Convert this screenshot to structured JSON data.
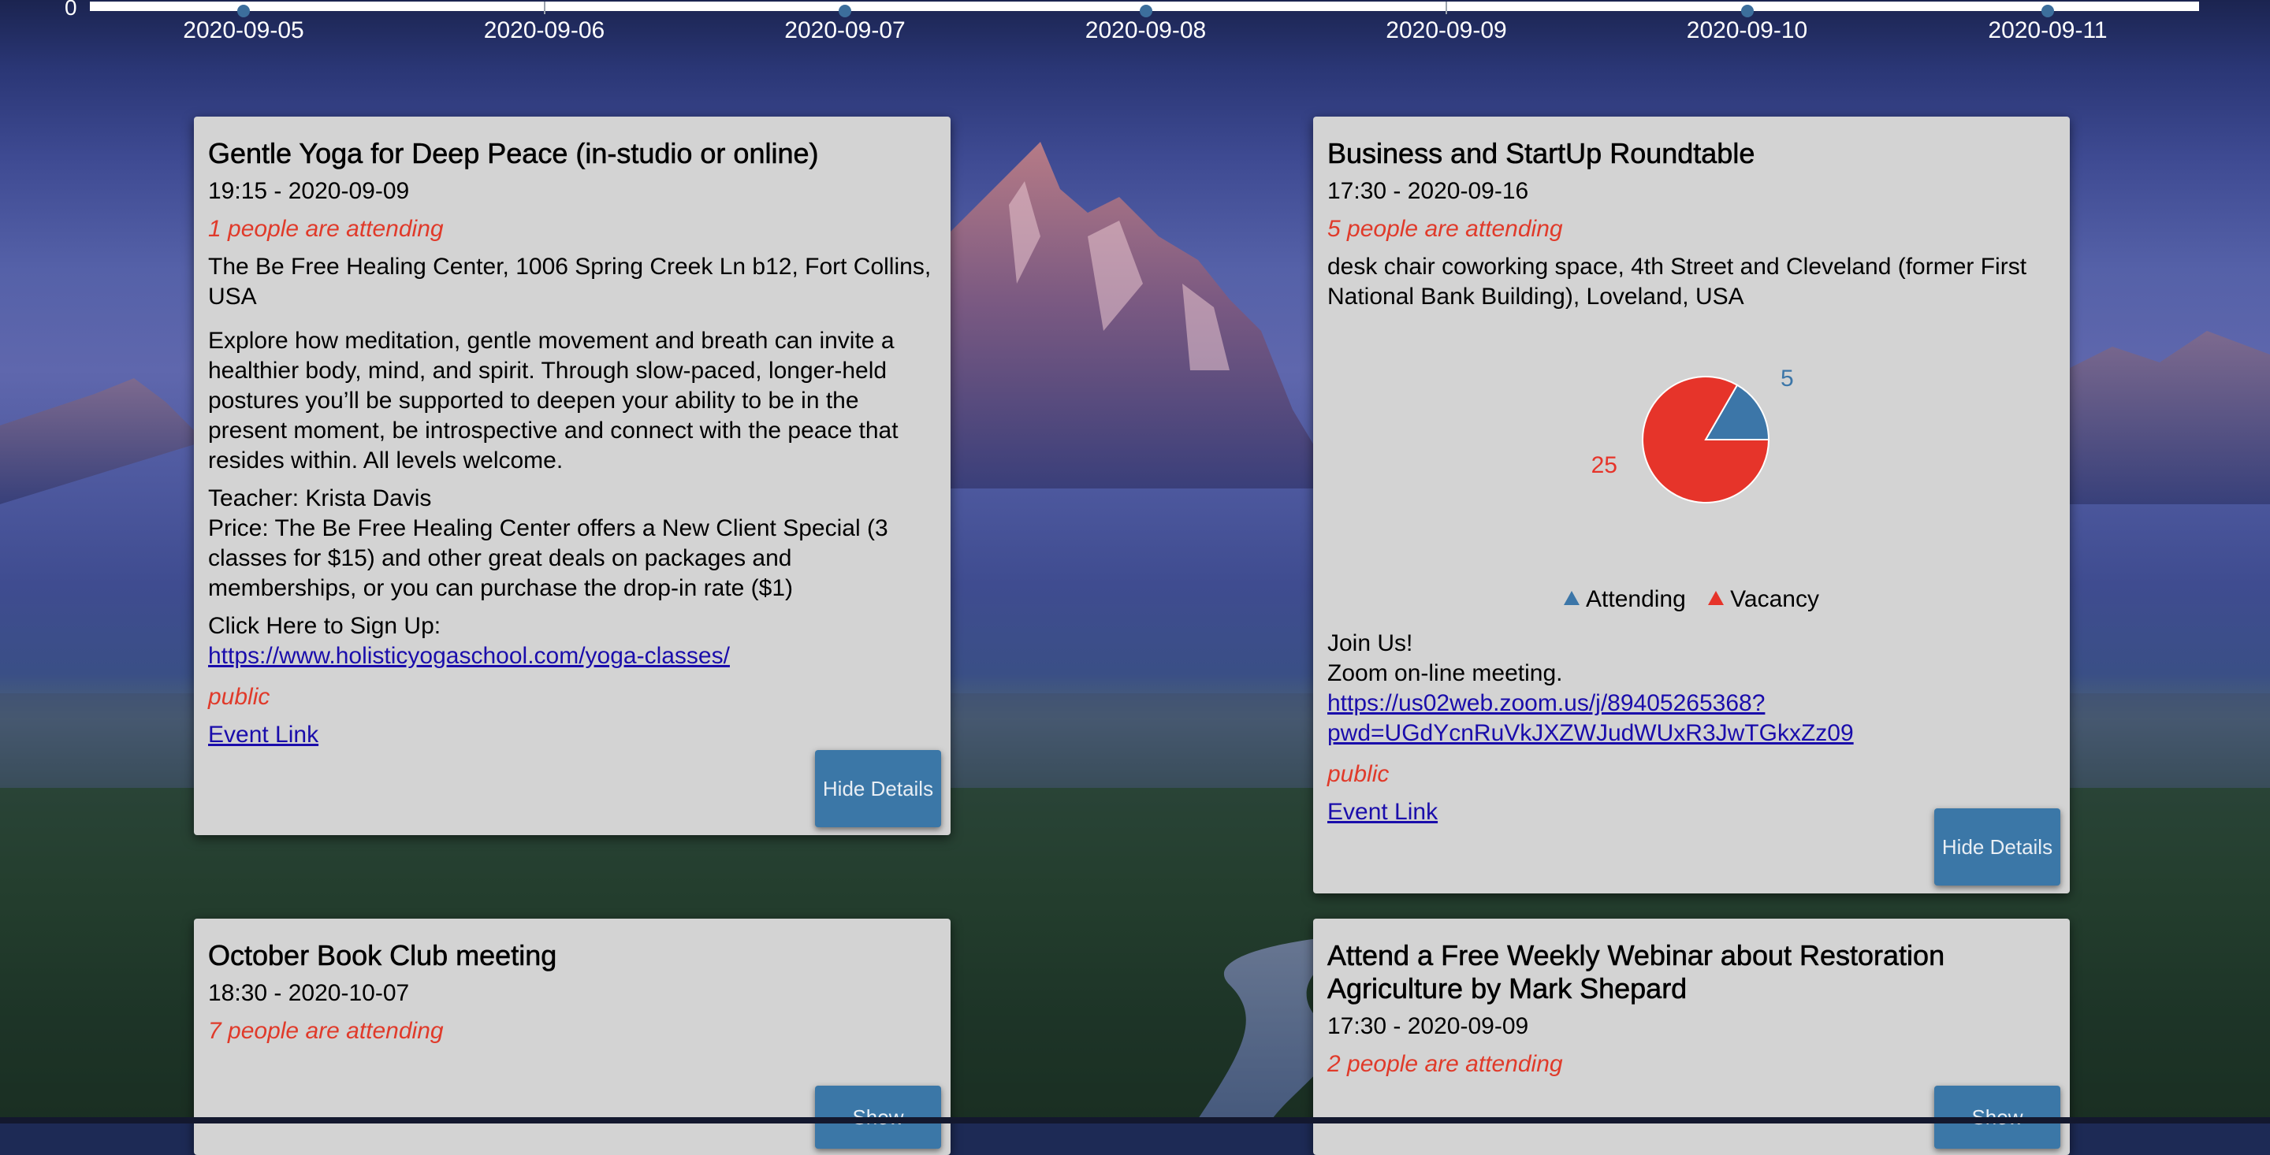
{
  "timeline": {
    "zero_label": "0",
    "dates": [
      "2020-09-05",
      "2020-09-06",
      "2020-09-07",
      "2020-09-08",
      "2020-09-09",
      "2020-09-10",
      "2020-09-11"
    ]
  },
  "events": [
    {
      "title": "Gentle Yoga for Deep Peace (in-studio or online)",
      "time": "19:15 - 2020-09-09",
      "attending": "1 people are attending",
      "location": "The Be Free Healing Center, 1006 Spring Creek Ln b12, Fort Collins, USA",
      "description": "Explore how meditation, gentle movement and breath can invite a healthier body, mind, and spirit. Through slow-paced, longer-held postures you’ll be supported to deepen your ability to be in the present moment, be introspective and connect with the peace that resides within. All levels welcome.",
      "teacher": "Teacher: Krista Davis",
      "price": "Price: The Be Free Healing Center offers a New Client Special (3 classes for $15) and other great deals on packages and memberships, or you can purchase the drop-in rate ($1)",
      "signup": "Click Here to Sign Up:",
      "link": "https://www.holisticyogaschool.com/yoga-classes/",
      "visibility": "public",
      "event_link": "Event Link",
      "button": "Hide Details"
    },
    {
      "title": "Business and StartUp Roundtable",
      "time": "17:30 - 2020-09-16",
      "attending": "5 people are attending",
      "location": "desk chair coworking space, 4th Street and Cleveland (former First National Bank Building), Loveland, USA",
      "join": "Join Us!",
      "zoom": "Zoom on-line meeting.",
      "link_line1": "https://us02web.zoom.us/j/89405265368?",
      "link_line2": "pwd=UGdYcnRuVkJXZWJudWUxR3JwTGkxZz09",
      "visibility": "public",
      "event_link": "Event Link",
      "button": "Hide Details"
    },
    {
      "title": "October Book Club meeting",
      "time": "18:30 - 2020-10-07",
      "attending": "7 people are attending",
      "button": "Show"
    },
    {
      "title": "Attend a Free Weekly Webinar about Restoration Agriculture by Mark Shepard",
      "time": "17:30 - 2020-09-09",
      "attending": "2 people are attending",
      "button": "Show"
    }
  ],
  "chart_data": {
    "type": "pie",
    "labels": [
      "Attending",
      "Vacancy"
    ],
    "values": [
      5,
      25
    ],
    "colors": [
      "#3c76a8",
      "#e6342a"
    ],
    "legend_position": "bottom"
  },
  "colors": {
    "card_bg": "#d3d3d3",
    "attending_red": "#e03a2a",
    "button_blue": "#3b77a7",
    "link_blue": "#1a0dab"
  }
}
